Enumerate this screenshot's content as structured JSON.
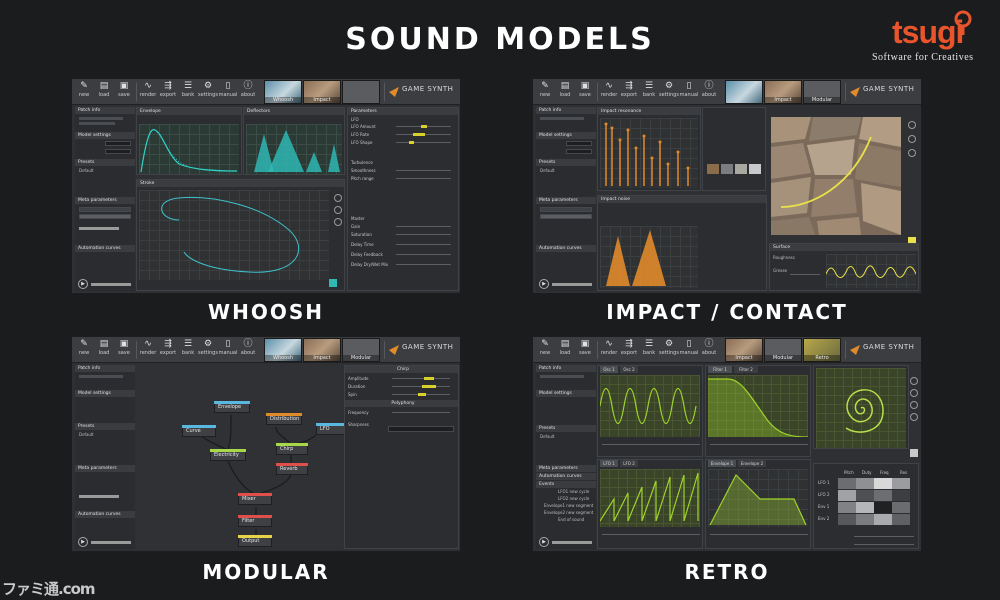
{
  "title": "SOUND MODELS",
  "logo": {
    "word": "tsugi",
    "tagline": "Software for Creatives",
    "color": "#e8542c"
  },
  "watermark": "ファミ通.com",
  "toolbar_buttons": [
    "new",
    "load",
    "save",
    "render",
    "export",
    "bank",
    "settings",
    "manual",
    "about"
  ],
  "brand": "GAME SYNTH",
  "colors": {
    "accent_yellow": "#d9d12b",
    "teal": "#2fb7b4",
    "orange": "#e08a2a",
    "lime": "#9fd32b",
    "background": "#1b1c1e"
  },
  "sidebar": {
    "patch_info": "Patch info",
    "model_settings": "Model settings",
    "presets": "Presets",
    "default": "Default",
    "meta_parameters": "Meta parameters",
    "automation_curves": "Automation curves",
    "variation": "Variation"
  },
  "screens": [
    {
      "caption": "WHOOSH",
      "tabs": [
        "Whoosh",
        "Impact"
      ],
      "panels": {
        "envelope": "Envelope",
        "deflectors": "Deflectors",
        "stroke": "Stroke",
        "parameters": "Parameters"
      },
      "params_lfo": [
        "LFO",
        "LFO Amount",
        "LFO Rate",
        "LFO Shape"
      ],
      "params_turbulence": [
        "Turbulence",
        "Smoothness",
        "Pitch range"
      ],
      "params_master": [
        "Master",
        "Gain",
        "Saturation",
        "Delay Time",
        "Delay Feedback",
        "Delay Dry/Wet Mix"
      ]
    },
    {
      "caption": "IMPACT / CONTACT",
      "tabs": [
        "Impact",
        "Modular"
      ],
      "panels": {
        "resonance": "Impact resonance",
        "noise": "Impact noise",
        "surface": "Surface"
      },
      "surface_labels": [
        "Roughness",
        "Grease"
      ]
    },
    {
      "caption": "MODULAR",
      "tabs": [
        "Whoosh",
        "Impact",
        "Modular"
      ],
      "nodes": [
        "Envelope",
        "Distribution",
        "Curve",
        "LFO",
        "Electricity",
        "Chirp",
        "Reverb",
        "Mixer",
        "Filter",
        "Output"
      ],
      "props_title": "Chirp",
      "props": [
        "Amplitude",
        "Duration",
        "Spin",
        "Polyphony",
        "Frequency",
        "Sharpness"
      ]
    },
    {
      "caption": "RETRO",
      "tabs": [
        "Impact",
        "Modular",
        "Retro"
      ],
      "osc_tabs": [
        "Osc 1",
        "Osc 2",
        "LFO 1",
        "LFO 2"
      ],
      "filter_tabs": [
        "Filter 1",
        "Filter 2"
      ],
      "env_tabs": [
        "Envelope 1",
        "Envelope 2"
      ],
      "events": [
        "Events",
        "LFO1 new cycle",
        "LFO2 new cycle",
        "Envelope1 new segment",
        "Envelope2 new segment",
        "End of sound"
      ],
      "matrix_cols": [
        "Pitch",
        "Duty",
        "Freq",
        "Res"
      ],
      "matrix_rows": [
        "LFO 1",
        "LFO 2",
        "Env 1",
        "Env 2"
      ]
    }
  ]
}
